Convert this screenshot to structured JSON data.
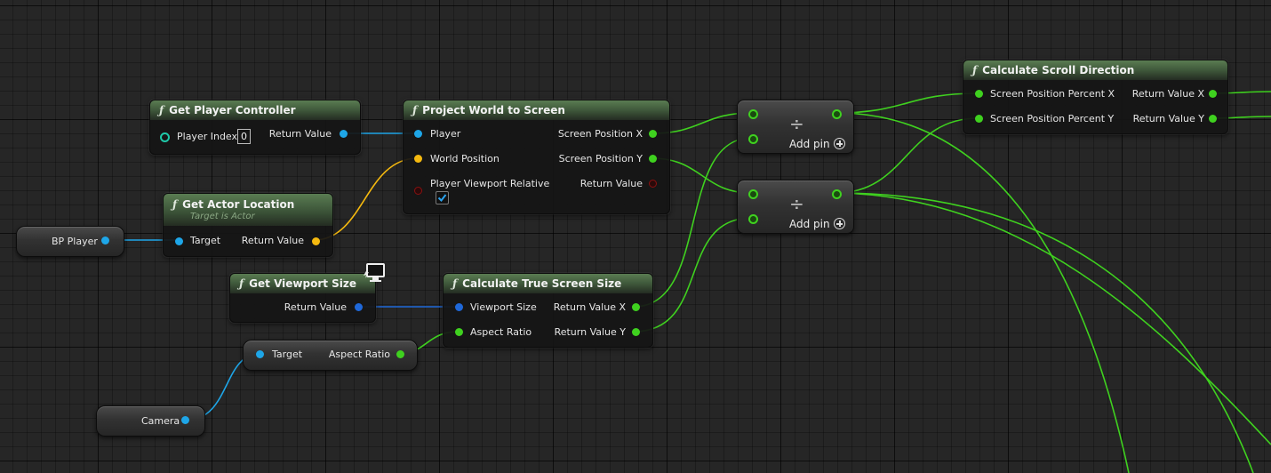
{
  "colors": {
    "exec_green": "#3fd11f",
    "object_blue": "#1ea6e8",
    "struct_yellow": "#f5b90f",
    "bool_red": "#8a1010",
    "vector2d_blue": "#1f68d9",
    "int_teal": "#1fc8a8"
  },
  "nodes": {
    "get_player_controller": {
      "title": "Get Player Controller",
      "icon": "function-icon",
      "player_index_label": "Player Index",
      "player_index_value": "0",
      "return_label": "Return Value"
    },
    "get_actor_location": {
      "title": "Get Actor Location",
      "subtitle": "Target is Actor",
      "icon": "function-icon",
      "target_label": "Target",
      "return_label": "Return Value"
    },
    "bp_player": {
      "label": "BP Player"
    },
    "project_world_to_screen": {
      "title": "Project World to Screen",
      "icon": "function-icon",
      "player_label": "Player",
      "world_position_label": "World Position",
      "viewport_relative_label": "Player Viewport Relative",
      "viewport_relative_checked": true,
      "screen_x_label": "Screen Position X",
      "screen_y_label": "Screen Position Y",
      "return_label": "Return Value"
    },
    "get_viewport_size": {
      "title": "Get Viewport Size",
      "icon": "function-icon",
      "return_label": "Return Value",
      "badge_icon": "client-only-monitor-icon"
    },
    "calculate_true_screen_size": {
      "title": "Calculate True Screen Size",
      "icon": "function-icon",
      "viewport_size_label": "Viewport Size",
      "aspect_ratio_label": "Aspect Ratio",
      "return_x_label": "Return Value X",
      "return_y_label": "Return Value Y"
    },
    "aspect_ratio_getter": {
      "target_label": "Target",
      "output_label": "Aspect Ratio"
    },
    "camera": {
      "label": "Camera"
    },
    "divide_1": {
      "symbol": "÷",
      "add_pin_label": "Add pin"
    },
    "divide_2": {
      "symbol": "÷",
      "add_pin_label": "Add pin"
    },
    "calculate_scroll_direction": {
      "title": "Calculate Scroll Direction",
      "icon": "function-icon",
      "input_x_label": "Screen Position Percent X",
      "input_y_label": "Screen Position Percent Y",
      "return_x_label": "Return Value X",
      "return_y_label": "Return Value Y"
    }
  }
}
